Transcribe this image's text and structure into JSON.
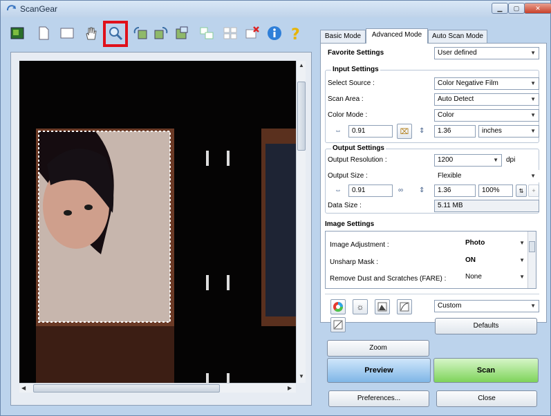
{
  "window": {
    "title": "ScanGear"
  },
  "toolbar": {
    "items": [
      {
        "name": "thumbnail-icon"
      },
      {
        "name": "whole-image-icon"
      },
      {
        "name": "crop-frame-icon"
      },
      {
        "name": "hand-icon"
      },
      {
        "name": "zoom-icon"
      },
      {
        "name": "rotate-left-icon"
      },
      {
        "name": "rotate-right-icon"
      },
      {
        "name": "auto-crop-icon"
      },
      {
        "name": "check-all-frames-icon"
      },
      {
        "name": "select-all-icon"
      },
      {
        "name": "remove-crop-frame-icon"
      },
      {
        "name": "info-icon"
      },
      {
        "name": "help-icon"
      }
    ]
  },
  "tabs": [
    "Basic Mode",
    "Advanced Mode",
    "Auto Scan Mode"
  ],
  "favorite": {
    "label": "Favorite Settings",
    "value": "User defined"
  },
  "input_settings": {
    "title": "Input Settings",
    "source_label": "Select Source :",
    "source_value": "Color Negative Film",
    "area_label": "Scan Area :",
    "area_value": "Auto Detect",
    "mode_label": "Color Mode :",
    "mode_value": "Color",
    "width": "0.91",
    "height": "1.36",
    "unit": "inches"
  },
  "output_settings": {
    "title": "Output Settings",
    "resolution_label": "Output Resolution :",
    "resolution_value": "1200",
    "resolution_unit": "dpi",
    "size_label": "Output Size :",
    "size_value": "Flexible",
    "width": "0.91",
    "height": "1.36",
    "scale": "100%",
    "datasize_label": "Data Size :",
    "datasize_value": "5.11 MB"
  },
  "image_settings": {
    "title": "Image Settings",
    "rows": [
      {
        "label": "Image Adjustment :",
        "value": "Photo"
      },
      {
        "label": "Unsharp Mask :",
        "value": "ON"
      },
      {
        "label": "Remove Dust and Scratches (FARE) :",
        "value": "None"
      }
    ]
  },
  "adjust": {
    "preset": "Custom",
    "defaults": "Defaults"
  },
  "buttons": {
    "zoom": "Zoom",
    "preview": "Preview",
    "scan": "Scan",
    "preferences": "Preferences...",
    "close": "Close"
  },
  "colors": {
    "highlight": "#e0101a",
    "preview_btn": "#8cc0ec",
    "scan_btn": "#8ee06a"
  }
}
